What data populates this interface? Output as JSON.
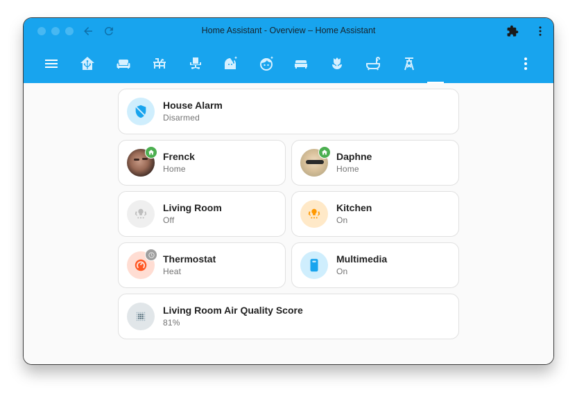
{
  "window": {
    "title": "Home Assistant - Overview – Home Assistant",
    "controls": [
      "close",
      "minimize",
      "maximize"
    ],
    "nav_back_icon": "arrow-left-icon",
    "reload_icon": "reload-icon",
    "extensions_icon": "puzzle-icon",
    "browser_menu_icon": "dots-vertical-icon"
  },
  "toolbar": {
    "menu_icon": "hamburger-menu-icon",
    "views": [
      {
        "icon": "home-assistant-icon",
        "name": "Home"
      },
      {
        "icon": "sofa-icon",
        "name": "Living Room"
      },
      {
        "icon": "desk-icon",
        "name": "Kitchen"
      },
      {
        "icon": "office-chair-icon",
        "name": "Office"
      },
      {
        "icon": "face-woman-shimmer-icon",
        "name": "Kids Room 1"
      },
      {
        "icon": "face-man-shimmer-icon",
        "name": "Kids Room 2"
      },
      {
        "icon": "bed-icon",
        "name": "Bedroom"
      },
      {
        "icon": "flower-tulip-icon",
        "name": "Garden"
      },
      {
        "icon": "bathtub-icon",
        "name": "Bathroom"
      },
      {
        "icon": "transmission-tower-icon",
        "name": "Energy"
      }
    ],
    "active_view_index": 10,
    "overflow_icon": "dots-vertical-icon"
  },
  "colors": {
    "primary": "#18a4ee",
    "active_green": "#4caf50",
    "light_on": "#ff9800",
    "heat": "#ff5722",
    "info_blue": "#03a9f4",
    "off_grey": "#9e9e9e",
    "air_quality": "#546e7a"
  },
  "cards": [
    {
      "name": "House Alarm",
      "state": "Disarmed",
      "icon": "shield-off-icon"
    },
    {
      "name": "Frenck",
      "state": "Home",
      "icon": "person-avatar",
      "badge": "home-icon"
    },
    {
      "name": "Daphne",
      "state": "Home",
      "icon": "person-avatar",
      "badge": "home-icon"
    },
    {
      "name": "Living Room",
      "state": "Off",
      "icon": "ceiling-light-multiple-icon"
    },
    {
      "name": "Kitchen",
      "state": "On",
      "icon": "ceiling-light-multiple-icon"
    },
    {
      "name": "Thermostat",
      "state": "Heat",
      "icon": "thermostat-icon",
      "badge": "clock-icon"
    },
    {
      "name": "Multimedia",
      "state": "On",
      "icon": "remote-icon"
    },
    {
      "name": "Living Room Air Quality Score",
      "state": "81%",
      "icon": "air-quality-dots-icon"
    }
  ]
}
